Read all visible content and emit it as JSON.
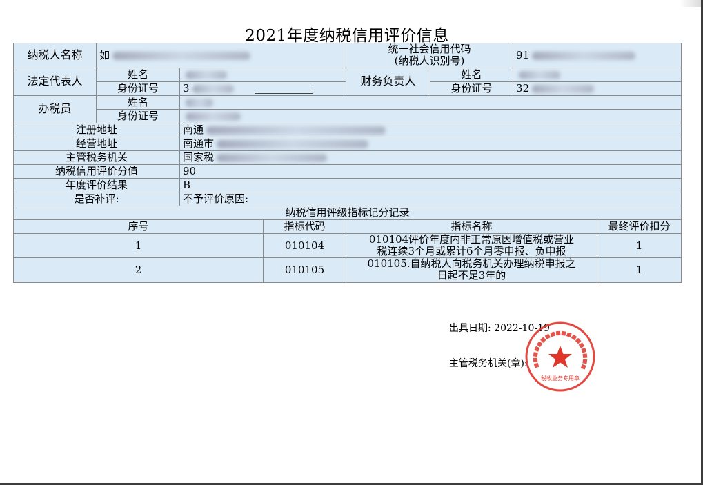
{
  "title": "2021年度纳税信用评价信息",
  "taxpayer": {
    "name_label": "纳税人名称",
    "name_value": "如",
    "credit_code_label_1": "统一社会信用代码",
    "credit_code_label_2": "(纳税人识别号)",
    "credit_code_value": "91"
  },
  "legal_rep": {
    "label": "法定代表人",
    "name_label": "姓名",
    "name_value": "",
    "id_label": "身份证号",
    "id_value": "3"
  },
  "finance": {
    "label": "财务负责人",
    "name_label": "姓名",
    "name_value": "",
    "id_label": "身份证号",
    "id_value": "32"
  },
  "clerk": {
    "label": "办税员",
    "name_label": "姓名",
    "name_value": "",
    "id_label": "身份证号",
    "id_value": ""
  },
  "fields": {
    "reg_address_label": "注册地址",
    "reg_address_value": "南通",
    "biz_address_label": "经营地址",
    "biz_address_value": "南通市",
    "authority_label": "主管税务机关",
    "authority_value": "国家税",
    "score_label": "纳税信用评价分值",
    "score_value": "90",
    "result_label": "年度评价结果",
    "result_value": "B",
    "supplement_label": "是否补评:",
    "no_eval_reason_label": "不予评价原因:"
  },
  "records": {
    "section_title": "纳税信用评级指标记分记录",
    "headers": [
      "序号",
      "指标代码",
      "指标名称",
      "最终评价扣分"
    ],
    "rows": [
      {
        "no": "1",
        "code": "010104",
        "name": "010104评价年度内非正常原因增值税或营业税连续3个月或累计6个月零申报、负申报",
        "deduction": "1"
      },
      {
        "no": "2",
        "code": "010105",
        "name": "010105.自纳税人向税务机关办理纳税申报之日起不足3年的",
        "deduction": "1"
      }
    ]
  },
  "footer": {
    "issue_date_label": "出具日期:",
    "issue_date_value": "2022-10-19",
    "authority_label": "主管税务机关(章):"
  },
  "seal": {
    "text": "税收业务专用章",
    "color": "#e0352b"
  }
}
